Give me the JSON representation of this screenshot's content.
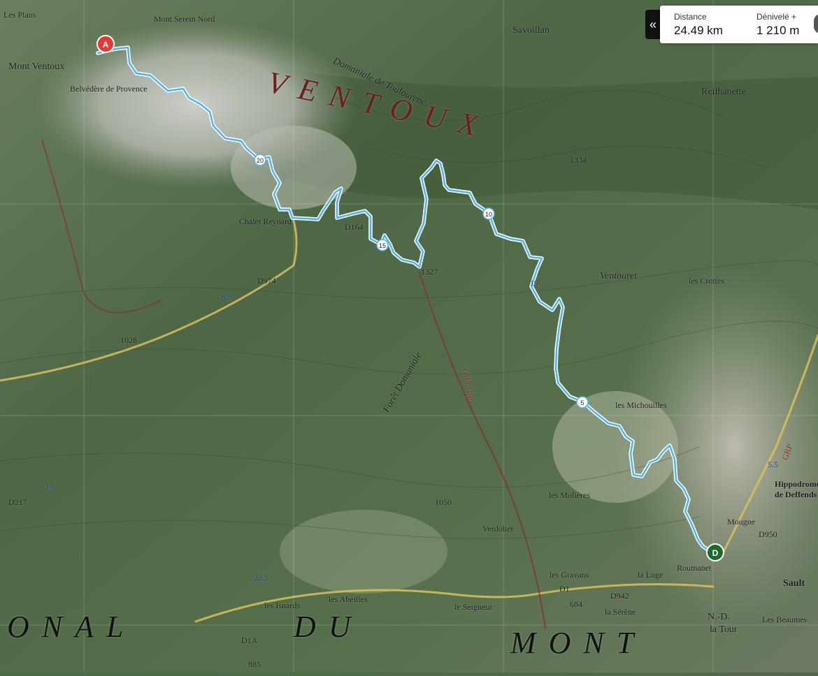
{
  "stats": {
    "distance_label": "Distance",
    "distance_value": "24.49 km",
    "elevation_label": "Dénivelé +",
    "elevation_value": "1 210 m"
  },
  "markers": {
    "start": "A",
    "end": "D",
    "km": [
      "5",
      "10",
      "15",
      "20"
    ]
  },
  "map_labels": {
    "places": [
      "Mont Ventoux",
      "Belvédère de Provence",
      "Chalet Reynard",
      "Savoillan",
      "Reilhanette",
      "Ventouret",
      "les Crottes",
      "les Michouilles",
      "les Molières",
      "Verdolier",
      "les Abeilles",
      "les Isnards",
      "le Seigneur",
      "Roumanet",
      "les Gravans",
      "la Sérène",
      "la Tour",
      "N.-D.",
      "Sault",
      "Hippodrome de Deffends",
      "Les Beaumes",
      "Mont Serein Nord",
      "Forêt Domaniale",
      "Domaniale de Toulourenc",
      "Mougne",
      "la Loge",
      "Les Plans"
    ],
    "big": [
      "VENTOUX",
      "ONAL",
      "DU",
      "MONT"
    ],
    "roads": [
      "D164",
      "D974",
      "D942",
      "D1",
      "D1A",
      "D217",
      "D950",
      "D942",
      "GR4-GR9",
      "GR91",
      "GRP"
    ],
    "numbers": [
      "1327",
      "1334",
      "1028",
      "1050",
      "684",
      "885",
      "6.5",
      "22.5",
      "13",
      "11",
      "5.5",
      "19",
      "10"
    ]
  },
  "colors": {
    "route": "#4fb3ea",
    "start_marker": "#e53935",
    "end_marker": "#1b6b2a"
  }
}
